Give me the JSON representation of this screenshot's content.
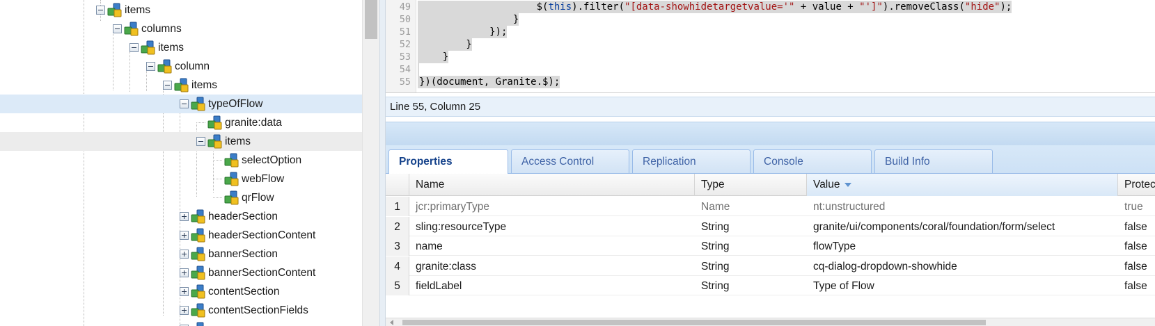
{
  "tree": {
    "nodes": [
      {
        "label": "items",
        "toggle": "minus",
        "state": ""
      },
      {
        "label": "columns",
        "toggle": "minus",
        "state": ""
      },
      {
        "label": "items",
        "toggle": "minus",
        "state": ""
      },
      {
        "label": "column",
        "toggle": "minus",
        "state": ""
      },
      {
        "label": "items",
        "toggle": "minus",
        "state": ""
      },
      {
        "label": "typeOfFlow",
        "toggle": "minus",
        "state": "selected"
      },
      {
        "label": "granite:data",
        "toggle": "none",
        "state": ""
      },
      {
        "label": "items",
        "toggle": "minus",
        "state": "hover"
      },
      {
        "label": "selectOption",
        "toggle": "none",
        "state": ""
      },
      {
        "label": "webFlow",
        "toggle": "none",
        "state": ""
      },
      {
        "label": "qrFlow",
        "toggle": "none",
        "state": ""
      },
      {
        "label": "headerSection",
        "toggle": "plus",
        "state": ""
      },
      {
        "label": "headerSectionContent",
        "toggle": "plus",
        "state": ""
      },
      {
        "label": "bannerSection",
        "toggle": "plus",
        "state": ""
      },
      {
        "label": "bannerSectionContent",
        "toggle": "plus",
        "state": ""
      },
      {
        "label": "contentSection",
        "toggle": "plus",
        "state": ""
      },
      {
        "label": "contentSectionFields",
        "toggle": "plus",
        "state": ""
      },
      {
        "label": "",
        "toggle": "plus",
        "state": ""
      }
    ]
  },
  "editor": {
    "lines": [
      {
        "num": "49",
        "segments": [
          {
            "t": "                    $(",
            "k": ""
          },
          {
            "t": "this",
            "k": "kw"
          },
          {
            "t": ").filter(",
            "k": ""
          },
          {
            "t": "\"[data-showhidetargetvalue='\"",
            "k": "str"
          },
          {
            "t": " + value + ",
            "k": ""
          },
          {
            "t": "\"']\"",
            "k": "str"
          },
          {
            "t": ").removeClass(",
            "k": ""
          },
          {
            "t": "\"hide\"",
            "k": "str"
          },
          {
            "t": ");",
            "k": ""
          }
        ]
      },
      {
        "num": "50",
        "segments": [
          {
            "t": "                }",
            "k": ""
          }
        ]
      },
      {
        "num": "51",
        "segments": [
          {
            "t": "            });",
            "k": ""
          }
        ]
      },
      {
        "num": "52",
        "segments": [
          {
            "t": "        }",
            "k": ""
          }
        ]
      },
      {
        "num": "53",
        "segments": [
          {
            "t": "    }",
            "k": ""
          }
        ]
      },
      {
        "num": "54",
        "segments": [
          {
            "t": "",
            "k": ""
          }
        ]
      },
      {
        "num": "55",
        "segments": [
          {
            "t": "})(document, Granite.$);",
            "k": ""
          }
        ]
      }
    ]
  },
  "status": {
    "text": "Line 55, Column 25"
  },
  "tabs": [
    {
      "label": "Properties",
      "active": true
    },
    {
      "label": "Access Control",
      "active": false
    },
    {
      "label": "Replication",
      "active": false
    },
    {
      "label": "Console",
      "active": false
    },
    {
      "label": "Build Info",
      "active": false
    }
  ],
  "grid": {
    "headers": {
      "name": "Name",
      "type": "Type",
      "value": "Value",
      "protected": "Protected"
    },
    "sorted_column": "value",
    "rows": [
      {
        "num": "1",
        "name": "jcr:primaryType",
        "type": "Name",
        "value": "nt:unstructured",
        "protected": "true"
      },
      {
        "num": "2",
        "name": "sling:resourceType",
        "type": "String",
        "value": "granite/ui/components/coral/foundation/form/select",
        "protected": "false"
      },
      {
        "num": "3",
        "name": "name",
        "type": "String",
        "value": "flowType",
        "protected": "false"
      },
      {
        "num": "4",
        "name": "granite:class",
        "type": "String",
        "value": "cq-dialog-dropdown-showhide",
        "protected": "false"
      },
      {
        "num": "5",
        "name": "fieldLabel",
        "type": "String",
        "value": "Type of Flow",
        "protected": "false"
      }
    ]
  },
  "colors": {
    "selection": "#dceaf8",
    "tab_text": "#3f63a6",
    "active_tab_text": "#15428b",
    "code_keyword": "#0a3f9e",
    "code_string": "#a31515"
  },
  "icons": {
    "tree_node": "cq-node-icon",
    "sort": "sort-descending-icon"
  }
}
